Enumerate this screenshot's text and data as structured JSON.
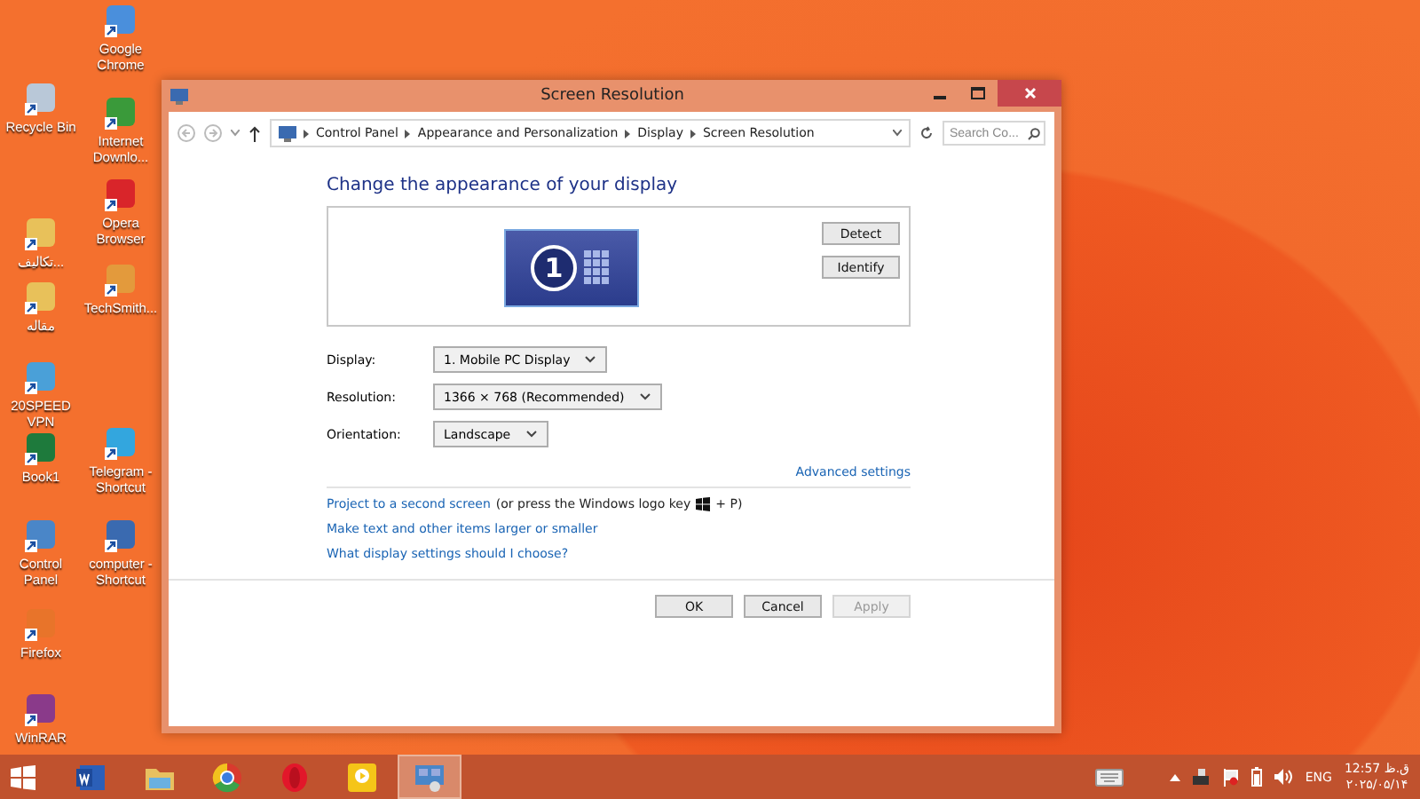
{
  "desktop_icons": [
    {
      "label": "Google Chrome"
    },
    {
      "label": "Recycle Bin"
    },
    {
      "label": "Internet Downlo..."
    },
    {
      "label": "Opera Browser"
    },
    {
      "label": "تکالیف..."
    },
    {
      "label": "TechSmith..."
    },
    {
      "label": "مقاله"
    },
    {
      "label": "20SPEED VPN"
    },
    {
      "label": "Book1"
    },
    {
      "label": "Telegram - Shortcut"
    },
    {
      "label": "Control Panel"
    },
    {
      "label": "computer - Shortcut"
    },
    {
      "label": "Firefox"
    },
    {
      "label": "WinRAR"
    }
  ],
  "window": {
    "title": "Screen Resolution",
    "breadcrumb": [
      "Control Panel",
      "Appearance and Personalization",
      "Display",
      "Screen Resolution"
    ],
    "search": {
      "placeholder": "Search Co..."
    },
    "heading": "Change the appearance of your display",
    "monitor_number": "1",
    "preview_buttons": [
      "Detect",
      "Identify"
    ],
    "fields": [
      {
        "label": "Display:",
        "value": "1. Mobile PC Display"
      },
      {
        "label": "Resolution:",
        "value": "1366 × 768 (Recommended)"
      },
      {
        "label": "Orientation:",
        "value": "Landscape"
      }
    ],
    "advanced_link": "Advanced settings",
    "links": [
      {
        "link": "Project to a second screen",
        "text": "(or press the Windows logo key",
        "suffix": "+ P)"
      },
      {
        "link": "Make text and other items larger or smaller"
      },
      {
        "link": "What display settings should I choose?"
      }
    ],
    "buttons": [
      {
        "label": "OK",
        "disabled": false
      },
      {
        "label": "Cancel",
        "disabled": false
      },
      {
        "label": "Apply",
        "disabled": true
      }
    ]
  },
  "taskbar": {
    "apps": [
      {
        "selected": false
      },
      {
        "selected": false
      },
      {
        "selected": false
      },
      {
        "selected": false
      },
      {
        "selected": false
      },
      {
        "selected": true
      }
    ],
    "language": "ENG",
    "time": "12:57 ق.ظ",
    "date": "۲۰۲۵/۰۵/۱۴"
  }
}
